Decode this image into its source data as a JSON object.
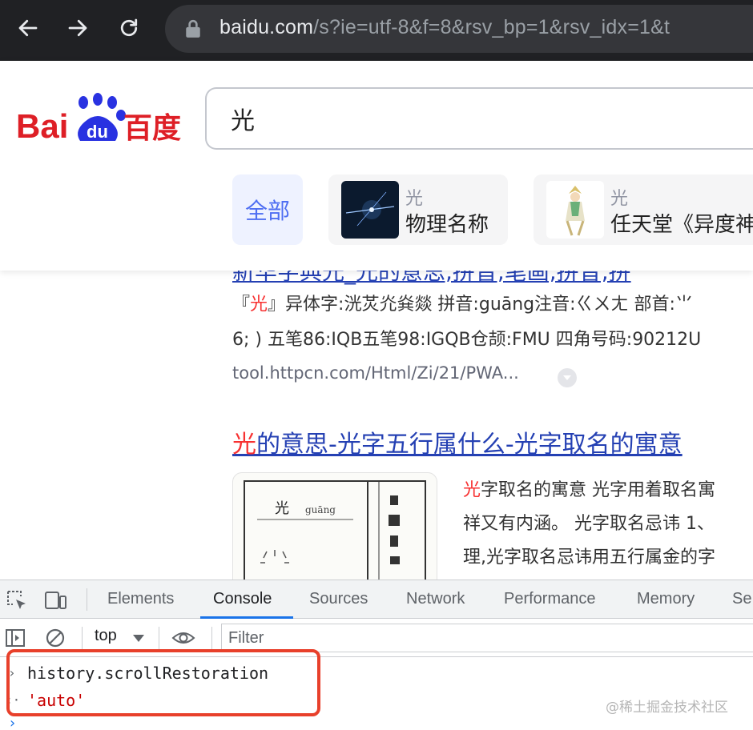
{
  "browser": {
    "url_host": "baidu.com",
    "url_path": "/s?ie=utf-8&f=8&rsv_bp=1&rsv_idx=1&t"
  },
  "baidu": {
    "logo_text_latin": "Bai",
    "logo_text_du": "du",
    "logo_text_cn": "百度",
    "search_query": "光",
    "tab_all": "全部",
    "cards": [
      {
        "keyword": "光",
        "desc": "物理名称"
      },
      {
        "keyword": "光",
        "desc": "任天堂《异度神"
      }
    ]
  },
  "results": {
    "partial_title": "新华字典光_光的意思,拼音,笔画,拼音,拼",
    "r1_snippet_line1_pre": "『",
    "r1_snippet_line1_hl": "光",
    "r1_snippet_line1_post": "』异体字:洸炗灮烡燚 拼音:guāng注音:ㄍㄨㄤ 部首:⺌",
    "r1_snippet_line2": "6; ) 五笔86:IQB五笔98:IGQB仓颉:FMU 四角号码:90212U",
    "r1_source": "tool.httpcn.com/Html/Zi/21/PWA...",
    "r2_title_hl": "光",
    "r2_title_rest": "的意思-光字五行属什么-光字取名的寓意",
    "r2_image_char": "光",
    "r2_image_pinyin": "guāng",
    "r2_line1_hl": "光",
    "r2_line1_rest": "字取名的寓意 光字用着取名寓",
    "r2_line2": "祥又有内涵。 光字取名忌讳 1、",
    "r2_line3": "理,光字取名忌讳用五行属金的字"
  },
  "devtools": {
    "tabs": [
      "Elements",
      "Console",
      "Sources",
      "Network",
      "Performance",
      "Memory",
      "Se"
    ],
    "active_tab": "Console",
    "context": "top",
    "filter_placeholder": "Filter",
    "input_line": "history.scrollRestoration",
    "output_line": "'auto'",
    "input_prompt": "›",
    "output_prompt": "‹·",
    "caret_prompt": "›"
  },
  "watermark": "@稀土掘金技术社区"
}
